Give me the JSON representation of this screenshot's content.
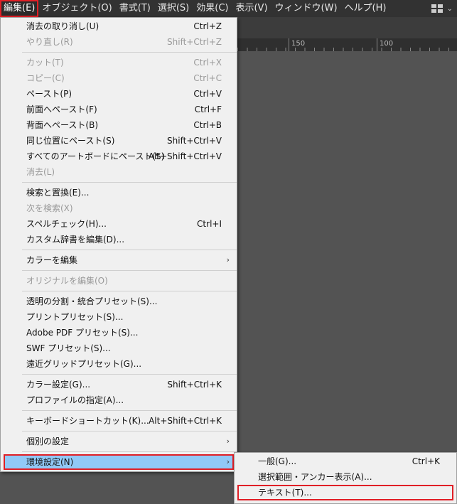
{
  "menubar": {
    "items": [
      "編集(E)",
      "オブジェクト(O)",
      "書式(T)",
      "選択(S)",
      "効果(C)",
      "表示(V)",
      "ウィンドウ(W)",
      "ヘルプ(H)"
    ],
    "workspace_chevron": "⌄"
  },
  "ruler": {
    "labels": [
      "150",
      "100"
    ]
  },
  "edit_menu": {
    "items": [
      {
        "label": "消去の取り消し(U)",
        "shortcut": "Ctrl+Z"
      },
      {
        "label": "やり直し(R)",
        "shortcut": "Shift+Ctrl+Z"
      },
      {
        "label": "カット(T)",
        "shortcut": "Ctrl+X"
      },
      {
        "label": "コピー(C)",
        "shortcut": "Ctrl+C"
      },
      {
        "label": "ペースト(P)",
        "shortcut": "Ctrl+V"
      },
      {
        "label": "前面へペースト(F)",
        "shortcut": "Ctrl+F"
      },
      {
        "label": "背面へペースト(B)",
        "shortcut": "Ctrl+B"
      },
      {
        "label": "同じ位置にペースト(S)",
        "shortcut": "Shift+Ctrl+V"
      },
      {
        "label": "すべてのアートボードにペースト(S)",
        "shortcut": "Alt+Shift+Ctrl+V"
      },
      {
        "label": "消去(L)",
        "shortcut": ""
      },
      {
        "label": "検索と置換(E)...",
        "shortcut": ""
      },
      {
        "label": "次を検索(X)",
        "shortcut": ""
      },
      {
        "label": "スペルチェック(H)...",
        "shortcut": "Ctrl+I"
      },
      {
        "label": "カスタム辞書を編集(D)...",
        "shortcut": ""
      },
      {
        "label": "カラーを編集",
        "shortcut": ""
      },
      {
        "label": "オリジナルを編集(O)",
        "shortcut": ""
      },
      {
        "label": "透明の分割・統合プリセット(S)...",
        "shortcut": ""
      },
      {
        "label": "プリントプリセット(S)...",
        "shortcut": ""
      },
      {
        "label": "Adobe PDF プリセット(S)...",
        "shortcut": ""
      },
      {
        "label": "SWF プリセット(S)...",
        "shortcut": ""
      },
      {
        "label": "遠近グリッドプリセット(G)...",
        "shortcut": ""
      },
      {
        "label": "カラー設定(G)...",
        "shortcut": "Shift+Ctrl+K"
      },
      {
        "label": "プロファイルの指定(A)...",
        "shortcut": ""
      },
      {
        "label": "キーボードショートカット(K)...",
        "shortcut": "Alt+Shift+Ctrl+K"
      },
      {
        "label": "個別の設定",
        "shortcut": ""
      },
      {
        "label": "環境設定(N)",
        "shortcut": ""
      }
    ],
    "submenu_arrow": "›"
  },
  "preferences_submenu": {
    "items": [
      {
        "label": "一般(G)...",
        "shortcut": "Ctrl+K"
      },
      {
        "label": "選択範囲・アンカー表示(A)...",
        "shortcut": ""
      },
      {
        "label": "テキスト(T)...",
        "shortcut": ""
      }
    ]
  },
  "colors": {
    "highlight": "#91c9f7",
    "annotation_red": "#e01f26",
    "menubar_bg": "#323232"
  }
}
